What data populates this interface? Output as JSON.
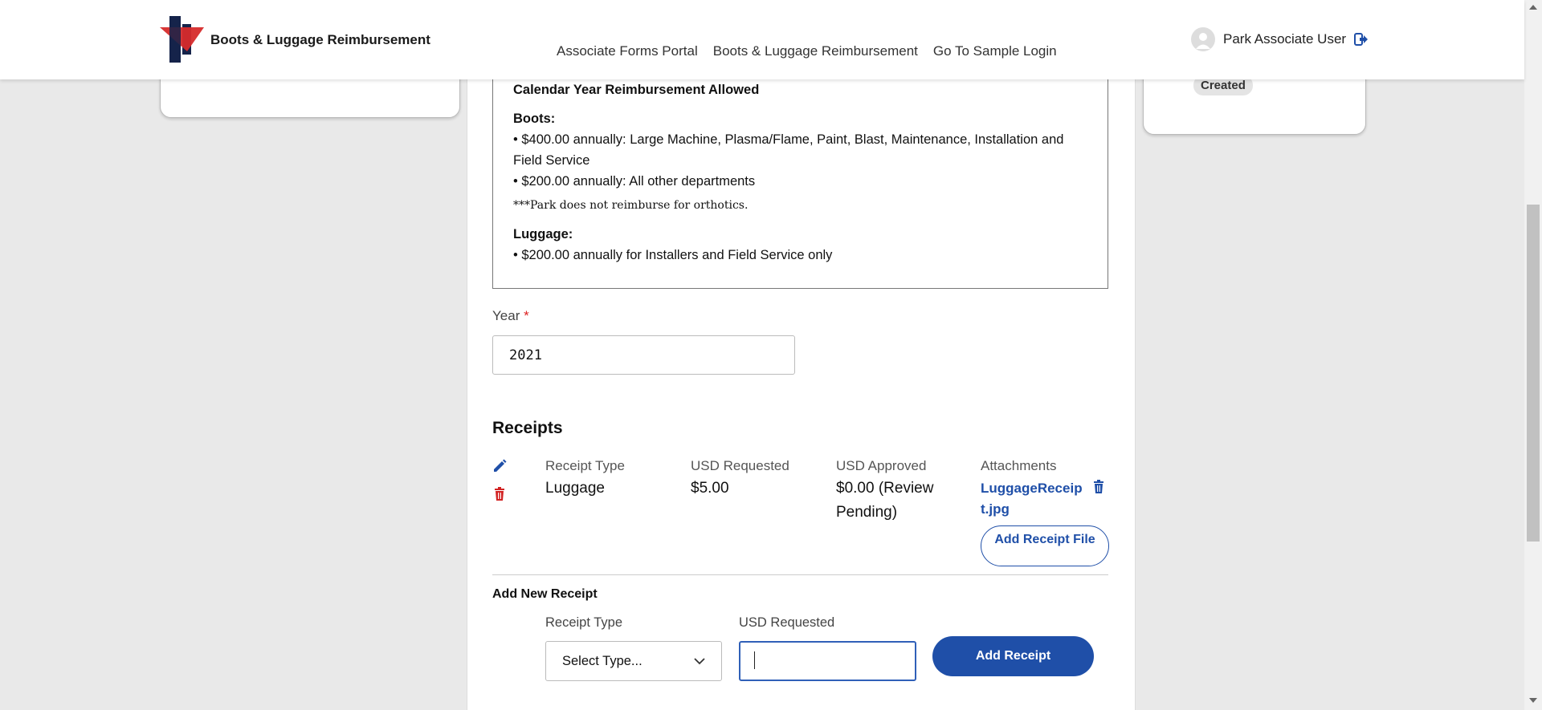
{
  "header": {
    "app_title": "Boots & Luggage Reimbursement",
    "nav": [
      "Associate Forms Portal",
      "Boots & Luggage Reimbursement",
      "Go To Sample Login"
    ],
    "user_name": "Park Associate User"
  },
  "status": {
    "badge": "Created"
  },
  "policy": {
    "heading": "Calendar Year Reimbursement Allowed",
    "boots_title": "Boots:",
    "boots_items": [
      "• $400.00 annually: Large Machine, Plasma/Flame, Paint, Blast, Maintenance, Installation and Field Service",
      "• $200.00 annually: All other departments"
    ],
    "note": "***Park does not reimburse for orthotics.",
    "luggage_title": "Luggage:",
    "luggage_items": [
      "• $200.00 annually for Installers and Field Service only"
    ]
  },
  "year": {
    "label": "Year",
    "required_mark": "*",
    "value": "2021"
  },
  "receipts": {
    "title": "Receipts",
    "columns": [
      "Receipt Type",
      "USD Requested",
      "USD Approved",
      "Attachments"
    ],
    "rows": [
      {
        "type": "Luggage",
        "requested": "$5.00",
        "approved": "$0.00 (Review Pending)",
        "attachment": "LuggageReceipt.jpg",
        "add_file_label": "Add Receipt File"
      }
    ]
  },
  "new_receipt": {
    "title": "Add New Receipt",
    "type_label": "Receipt Type",
    "type_value": "Select Type...",
    "usd_label": "USD Requested",
    "usd_value": "",
    "add_button": "Add Receipt"
  },
  "colors": {
    "accent": "#1f4fa8",
    "danger": "#d22222",
    "logo_red": "#d62b2b",
    "logo_navy": "#15234a"
  }
}
